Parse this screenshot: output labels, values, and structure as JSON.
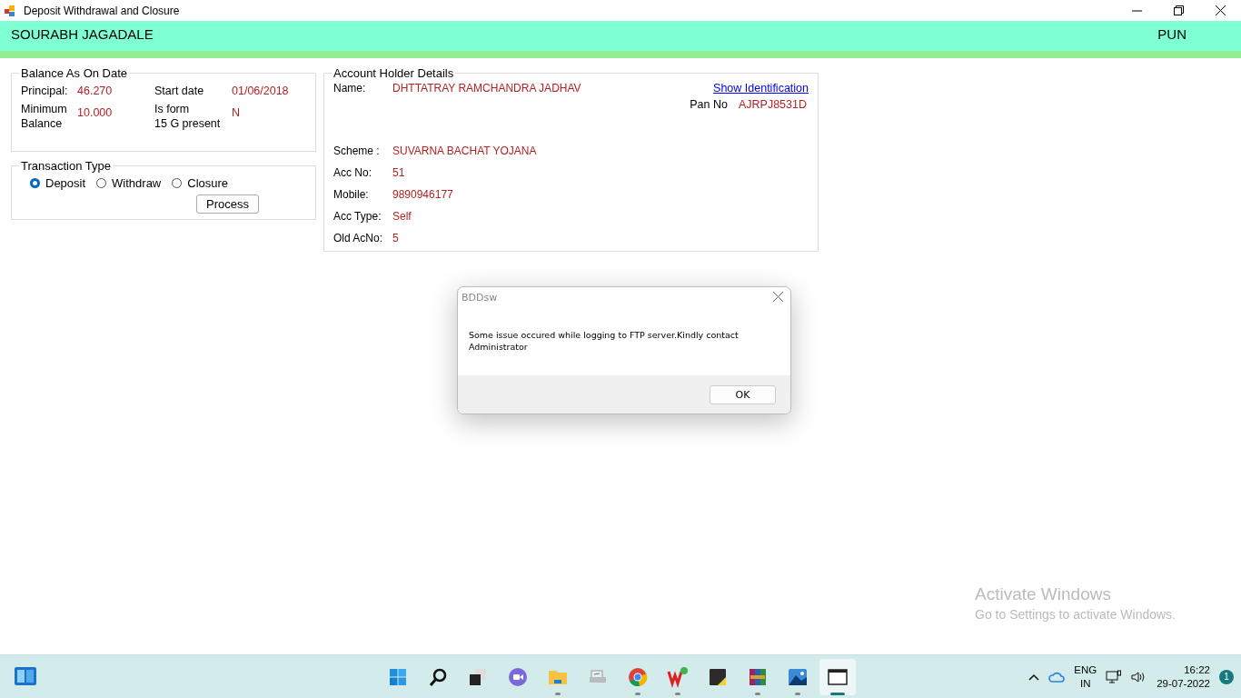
{
  "window": {
    "title": "Deposit Withdrawal and Closure"
  },
  "header": {
    "user": "SOURABH JAGADALE",
    "branch": "PUN"
  },
  "balance": {
    "title": "Balance As On Date",
    "fields": [
      {
        "label": "Principal:",
        "value": "46.270"
      },
      {
        "label": "Start date",
        "value": "01/06/2018"
      },
      {
        "label": "Minimum\nBalance",
        "value": "10.000"
      },
      {
        "label": "Is form\n15 G present",
        "value": "N"
      }
    ]
  },
  "transaction": {
    "title": "Transaction Type",
    "options": [
      {
        "label": "Deposit",
        "selected": true
      },
      {
        "label": "Withdraw",
        "selected": false
      },
      {
        "label": "Closure",
        "selected": false
      }
    ],
    "button": "Process"
  },
  "account": {
    "title": "Account Holder Details",
    "name_label": "Name:",
    "name": "DHTTATRAY RAMCHANDRA JADHAV",
    "link": "Show Identification",
    "pan_label": "Pan No",
    "pan": "AJRPJ8531D",
    "fields": [
      {
        "label": "Scheme :",
        "value": "SUVARNA BACHAT YOJANA"
      },
      {
        "label": "Acc No:",
        "value": "51"
      },
      {
        "label": "Mobile:",
        "value": "9890946177"
      },
      {
        "label": "Acc Type:",
        "value": "Self"
      },
      {
        "label": "Old AcNo:",
        "value": "5"
      }
    ]
  },
  "dialog": {
    "title": "BDDsw",
    "message": "Some issue occured while logging to FTP server.Kindly contact\nAdministrator",
    "button": "OK"
  },
  "activation": {
    "title": "Activate Windows",
    "subtitle": "Go to Settings to activate Windows."
  },
  "taskbar": {
    "apps": [
      {
        "kind": "start",
        "running": false,
        "selected": false
      },
      {
        "kind": "search",
        "running": false,
        "selected": false
      },
      {
        "kind": "taskview",
        "running": false,
        "selected": false
      },
      {
        "kind": "chat",
        "running": false,
        "selected": false
      },
      {
        "kind": "explorer",
        "running": true,
        "selected": false
      },
      {
        "kind": "printer",
        "running": false,
        "selected": false
      },
      {
        "kind": "chrome",
        "running": true,
        "selected": false
      },
      {
        "kind": "wps",
        "running": true,
        "selected": false
      },
      {
        "kind": "notes",
        "running": false,
        "selected": false
      },
      {
        "kind": "archive",
        "running": true,
        "selected": false
      },
      {
        "kind": "photos",
        "running": true,
        "selected": false
      },
      {
        "kind": "window",
        "running": true,
        "selected": true
      }
    ],
    "language": "ENG",
    "region": "IN",
    "time": "16:22",
    "date": "29-07-2022",
    "notifications": "1"
  }
}
